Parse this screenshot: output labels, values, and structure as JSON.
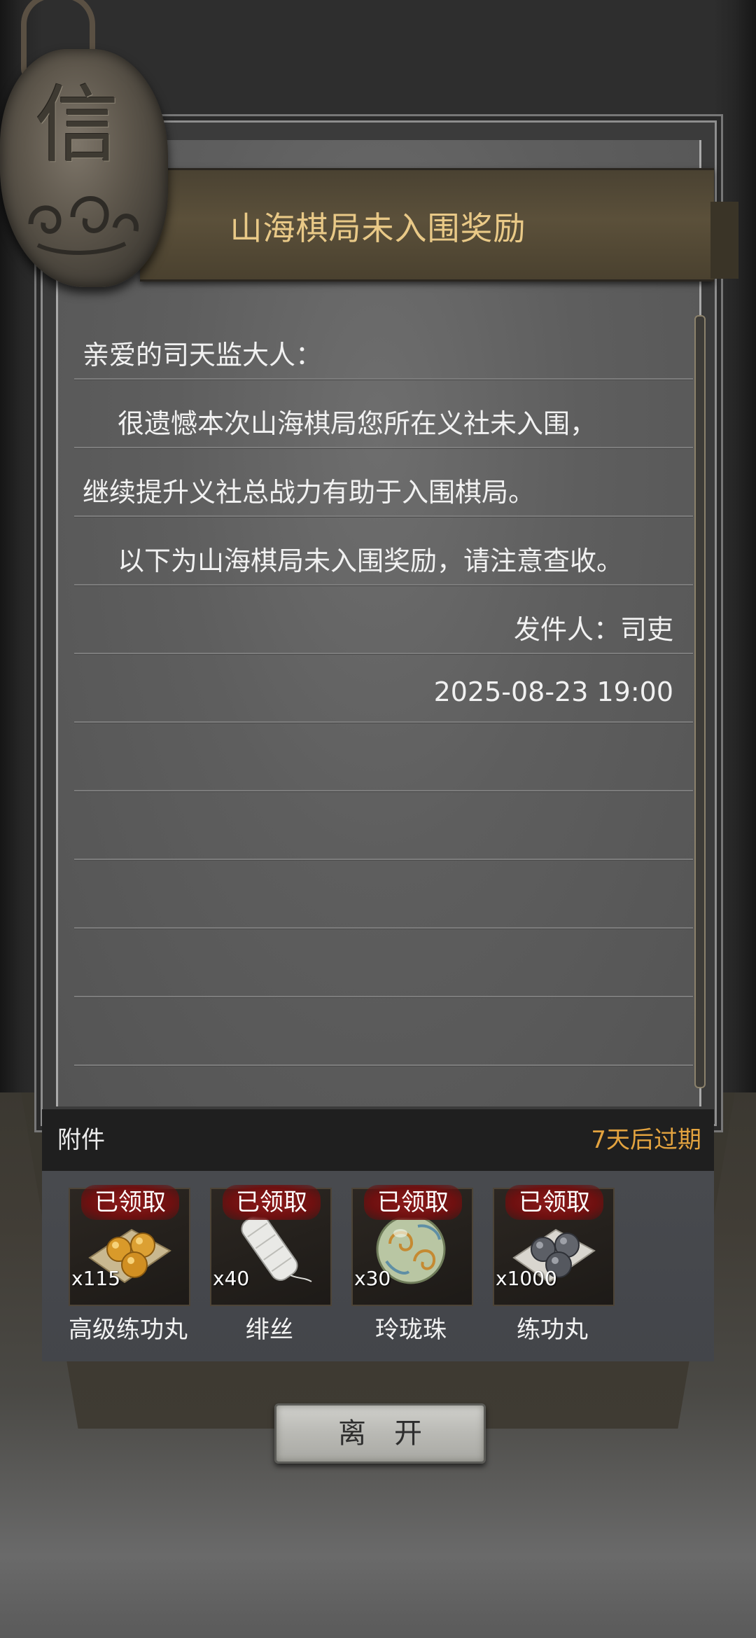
{
  "letter": {
    "seal_char": "信",
    "title": "山海棋局未入围奖励",
    "greeting": "亲爱的司天监大人：",
    "body_line1": "很遗憾本次山海棋局您所在义社未入围，",
    "body_line2": "继续提升义社总战力有助于入围棋局。",
    "body_line3": "以下为山海棋局未入围奖励，请注意查收。",
    "sender": "发件人：司吏",
    "timestamp": "2025-08-23 19:00"
  },
  "attachments": {
    "label": "附件",
    "expire_text": "7天后过期",
    "items": [
      {
        "badge": "已领取",
        "count": "x115",
        "name": "高级练功丸",
        "icon": "golden-pills-icon"
      },
      {
        "badge": "已领取",
        "count": "x40",
        "name": "绯丝",
        "icon": "silk-spool-icon"
      },
      {
        "badge": "已领取",
        "count": "x30",
        "name": "玲珑珠",
        "icon": "jade-orb-icon"
      },
      {
        "badge": "已领取",
        "count": "x1000",
        "name": "练功丸",
        "icon": "grey-pills-icon"
      }
    ]
  },
  "leave_button": {
    "label": "离开"
  },
  "colors": {
    "title": "#e9c987",
    "expire": "#e3a33f",
    "badge": "#8e1b1b"
  }
}
